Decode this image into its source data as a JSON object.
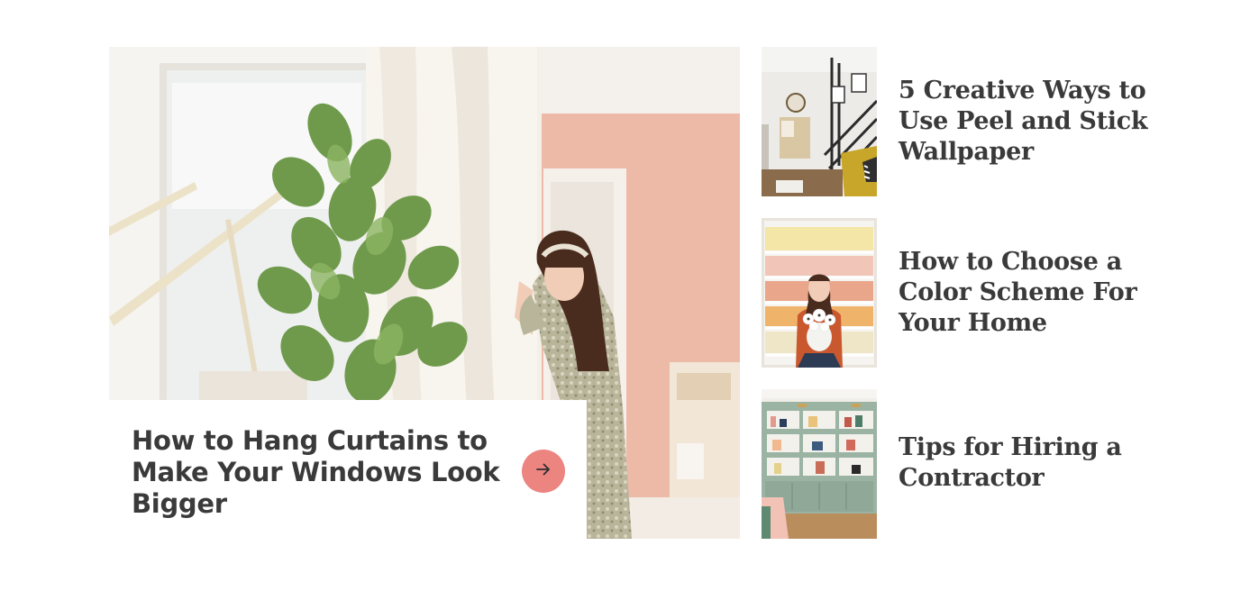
{
  "featured": {
    "title": "How to Hang Curtains to Make Your Windows Look Bigger",
    "image": "woman-opening-curtains-with-fiddle-leaf-plant",
    "arrow_icon": "arrow-right-icon",
    "arrow_color": "#ec8480"
  },
  "side_articles": [
    {
      "title": "5 Creative Ways to Use Peel and Stick Wallpaper",
      "image": "living-room-with-black-stair-railing"
    },
    {
      "title": "How to Choose a Color Scheme For Your Home",
      "image": "woman-holding-flowers-in-front-of-bookshelves"
    },
    {
      "title": "Tips for Hiring a Contractor",
      "image": "sage-green-built-in-shelves"
    }
  ],
  "colors": {
    "text": "#3a3a3a",
    "accent": "#ec8480",
    "background": "#ffffff"
  }
}
